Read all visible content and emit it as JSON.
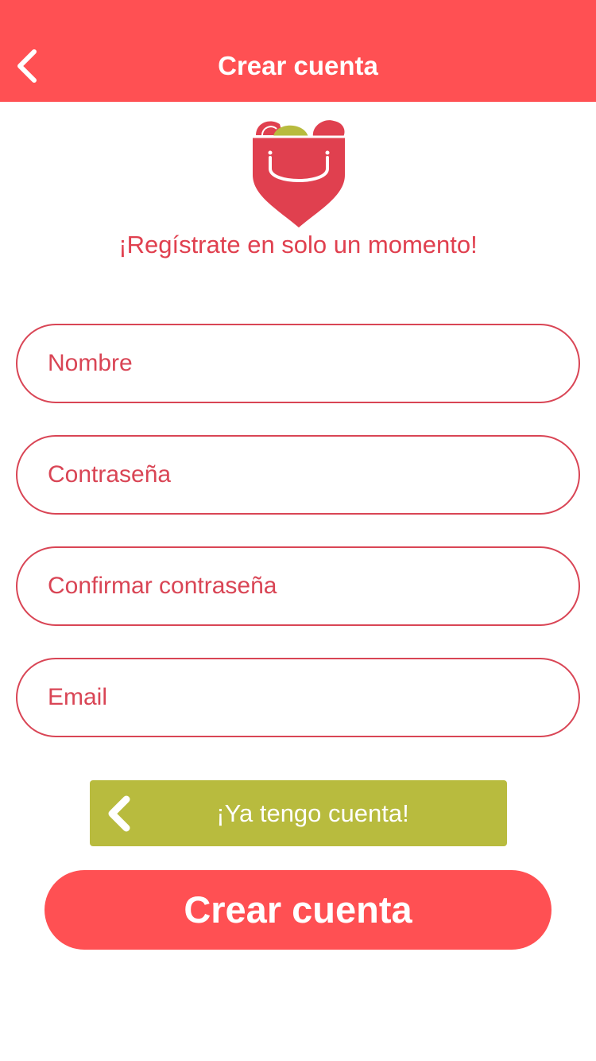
{
  "header": {
    "title": "Crear cuenta",
    "back_icon": "chevron-left-icon",
    "background_color": "#ff5053"
  },
  "logo": {
    "icon": "shopping-bag-pin-logo",
    "colors": {
      "primary": "#e0404f",
      "accent": "#b8bb3e"
    }
  },
  "tagline": "¡Regístrate en solo un momento!",
  "form": {
    "name_placeholder": "Nombre",
    "password_placeholder": "Contraseña",
    "confirm_password_placeholder": "Confirmar contraseña",
    "email_placeholder": "Email",
    "field_color": "#d94555"
  },
  "have_account_button": {
    "label": "¡Ya tengo cuenta!",
    "icon": "chevron-left-icon",
    "color": "#b8bb3e"
  },
  "create_button": {
    "label": "Crear cuenta",
    "color": "#ff5053"
  }
}
